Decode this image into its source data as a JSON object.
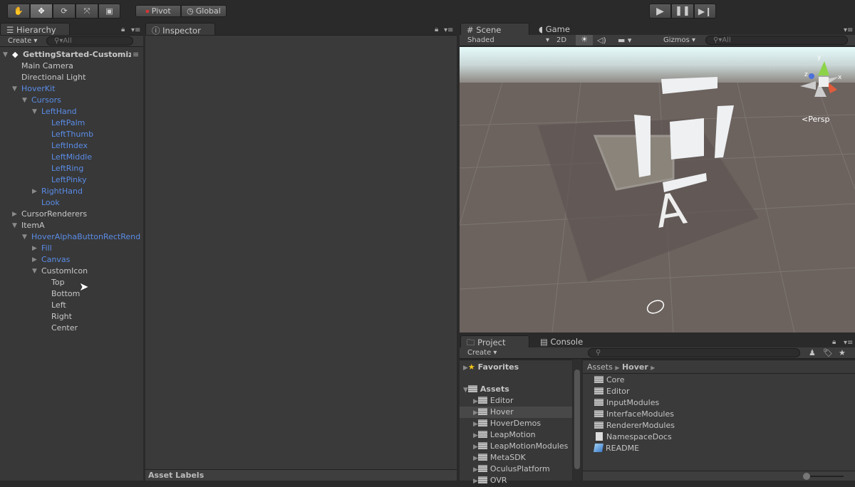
{
  "toolbar": {
    "tools": [
      "hand-tool",
      "move-tool",
      "rotate-tool",
      "scale-tool",
      "rect-tool"
    ],
    "pivot_label": "Pivot",
    "global_label": "Global",
    "play": "play",
    "pause": "pause",
    "step": "step"
  },
  "hierarchy": {
    "tab_label": "Hierarchy",
    "create_label": "Create",
    "search_placeholder": "All",
    "items": [
      {
        "label": "GettingStarted-Customize",
        "depth": 0,
        "arrow": "open",
        "style": "bold"
      },
      {
        "label": "Main Camera",
        "depth": 1,
        "arrow": "",
        "style": "white"
      },
      {
        "label": "Directional Light",
        "depth": 1,
        "arrow": "",
        "style": "white"
      },
      {
        "label": "HoverKit",
        "depth": 1,
        "arrow": "open",
        "style": "blue"
      },
      {
        "label": "Cursors",
        "depth": 2,
        "arrow": "open",
        "style": "blue"
      },
      {
        "label": "LeftHand",
        "depth": 3,
        "arrow": "open",
        "style": "blue"
      },
      {
        "label": "LeftPalm",
        "depth": 4,
        "arrow": "",
        "style": "blue"
      },
      {
        "label": "LeftThumb",
        "depth": 4,
        "arrow": "",
        "style": "blue"
      },
      {
        "label": "LeftIndex",
        "depth": 4,
        "arrow": "",
        "style": "blue"
      },
      {
        "label": "LeftMiddle",
        "depth": 4,
        "arrow": "",
        "style": "blue"
      },
      {
        "label": "LeftRing",
        "depth": 4,
        "arrow": "",
        "style": "blue"
      },
      {
        "label": "LeftPinky",
        "depth": 4,
        "arrow": "",
        "style": "blue"
      },
      {
        "label": "RightHand",
        "depth": 3,
        "arrow": "closed",
        "style": "blue"
      },
      {
        "label": "Look",
        "depth": 3,
        "arrow": "",
        "style": "blue"
      },
      {
        "label": "CursorRenderers",
        "depth": 1,
        "arrow": "closed",
        "style": "white"
      },
      {
        "label": "ItemA",
        "depth": 1,
        "arrow": "open",
        "style": "white"
      },
      {
        "label": "HoverAlphaButtonRectRend",
        "depth": 2,
        "arrow": "open",
        "style": "blue"
      },
      {
        "label": "Fill",
        "depth": 3,
        "arrow": "closed",
        "style": "blue"
      },
      {
        "label": "Canvas",
        "depth": 3,
        "arrow": "closed",
        "style": "blue"
      },
      {
        "label": "CustomIcon",
        "depth": 3,
        "arrow": "open",
        "style": "white"
      },
      {
        "label": "Top",
        "depth": 4,
        "arrow": "",
        "style": "white"
      },
      {
        "label": "Bottom",
        "depth": 4,
        "arrow": "",
        "style": "white"
      },
      {
        "label": "Left",
        "depth": 4,
        "arrow": "",
        "style": "white"
      },
      {
        "label": "Right",
        "depth": 4,
        "arrow": "",
        "style": "white"
      },
      {
        "label": "Center",
        "depth": 4,
        "arrow": "",
        "style": "white"
      }
    ]
  },
  "inspector": {
    "tab_label": "Inspector",
    "asset_labels": "Asset Labels"
  },
  "scene": {
    "tabs": [
      "Scene",
      "Game"
    ],
    "shading_mode": "Shaded",
    "mode_2d": "2D",
    "gizmos_label": "Gizmos",
    "search_placeholder": "All",
    "persp_label": "Persp",
    "gizmo_axes": [
      "y",
      "x",
      "z"
    ],
    "letter": "A"
  },
  "project": {
    "tabs": [
      "Project",
      "Console"
    ],
    "create_label": "Create",
    "favorites_label": "Favorites",
    "assets_label": "Assets",
    "tree": [
      "Editor",
      "Hover",
      "HoverDemos",
      "LeapMotion",
      "LeapMotionModules",
      "MetaSDK",
      "OculusPlatform",
      "OVR"
    ],
    "selected": "Hover",
    "breadcrumb": [
      "Assets",
      "Hover"
    ],
    "files": [
      {
        "label": "Core",
        "icon": "folder"
      },
      {
        "label": "Editor",
        "icon": "folder"
      },
      {
        "label": "InputModules",
        "icon": "folder"
      },
      {
        "label": "InterfaceModules",
        "icon": "folder"
      },
      {
        "label": "RendererModules",
        "icon": "folder"
      },
      {
        "label": "NamespaceDocs",
        "icon": "text-file"
      },
      {
        "label": "README",
        "icon": "readme"
      }
    ]
  }
}
